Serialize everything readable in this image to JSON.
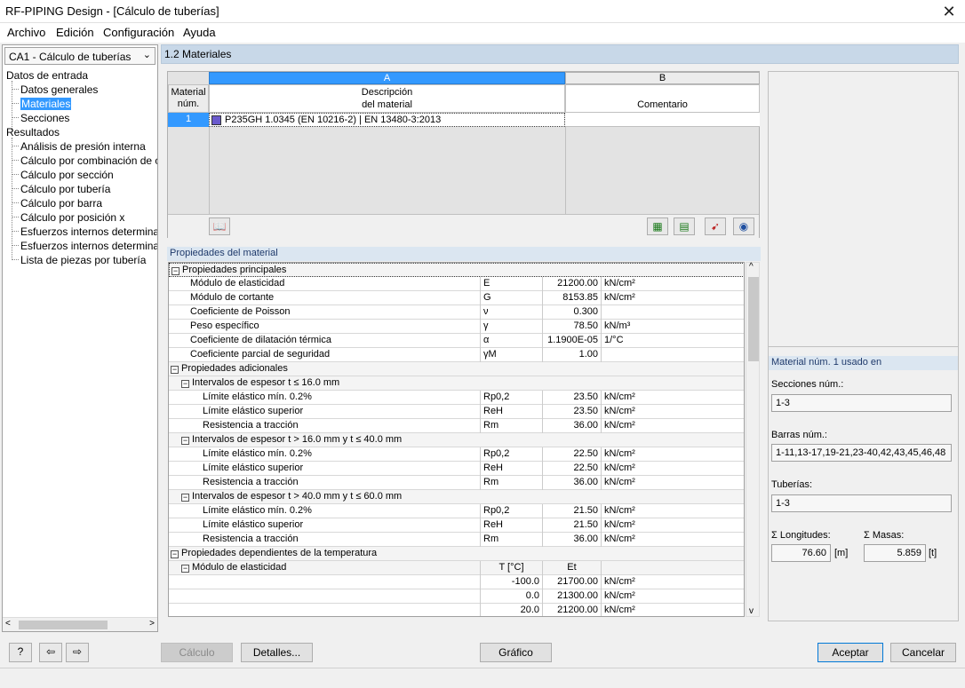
{
  "window": {
    "title": "RF-PIPING Design - [Cálculo de tuberías]"
  },
  "menu": [
    "Archivo",
    "Edición",
    "Configuración",
    "Ayuda"
  ],
  "navigator": {
    "case_select": "CA1 - Cálculo de tuberías",
    "items": [
      {
        "label": "Datos de entrada"
      },
      {
        "label": "Datos generales"
      },
      {
        "label": "Materiales"
      },
      {
        "label": "Secciones"
      },
      {
        "label": "Resultados"
      },
      {
        "label": "Análisis de presión interna"
      },
      {
        "label": "Cálculo por combinación de carg"
      },
      {
        "label": "Cálculo por sección"
      },
      {
        "label": "Cálculo por tubería"
      },
      {
        "label": "Cálculo por barra"
      },
      {
        "label": "Cálculo por posición x"
      },
      {
        "label": "Esfuerzos internos determinante"
      },
      {
        "label": "Esfuerzos internos determinante"
      },
      {
        "label": "Lista de piezas por tubería"
      }
    ]
  },
  "section_title": "1.2 Materiales",
  "materials_table": {
    "col_a": "A",
    "col_b": "B",
    "hdr_num": "Material\nnúm.",
    "hdr_desc": "Descripción\ndel material",
    "hdr_comment": "Comentario",
    "rows": [
      {
        "num": "1",
        "desc": "P235GH 1.0345 (EN 10216-2) | EN 13480-3:2013",
        "comment": "",
        "color": "#6a5acd"
      }
    ]
  },
  "properties": {
    "title": "Propiedades del material",
    "rows": [
      {
        "name": "Propiedades principales",
        "sym": "",
        "val": "",
        "unit": ""
      },
      {
        "name": "Módulo de elasticidad",
        "sym": "E",
        "val": "21200.00",
        "unit": "kN/cm²"
      },
      {
        "name": "Módulo de cortante",
        "sym": "G",
        "val": "8153.85",
        "unit": "kN/cm²"
      },
      {
        "name": "Coeficiente de Poisson",
        "sym": "ν",
        "val": "0.300",
        "unit": ""
      },
      {
        "name": "Peso específico",
        "sym": "γ",
        "val": "78.50",
        "unit": "kN/m³"
      },
      {
        "name": "Coeficiente de dilatación térmica",
        "sym": "α",
        "val": "1.1900E-05",
        "unit": "1/°C"
      },
      {
        "name": "Coeficiente parcial de seguridad",
        "sym": "γM",
        "val": "1.00",
        "unit": ""
      },
      {
        "name": "Propiedades adicionales",
        "sym": "",
        "val": "",
        "unit": ""
      },
      {
        "name": "Intervalos de espesor t ≤ 16.0 mm",
        "sym": "",
        "val": "",
        "unit": ""
      },
      {
        "name": "Límite elástico mín. 0.2%",
        "sym": "Rp0,2",
        "val": "23.50",
        "unit": "kN/cm²"
      },
      {
        "name": "Límite elástico superior",
        "sym": "ReH",
        "val": "23.50",
        "unit": "kN/cm²"
      },
      {
        "name": "Resistencia a tracción",
        "sym": "Rm",
        "val": "36.00",
        "unit": "kN/cm²"
      },
      {
        "name": "Intervalos de espesor t > 16.0 mm y t ≤ 40.0 mm",
        "sym": "",
        "val": "",
        "unit": ""
      },
      {
        "name": "Límite elástico mín. 0.2%",
        "sym": "Rp0,2",
        "val": "22.50",
        "unit": "kN/cm²"
      },
      {
        "name": "Límite elástico superior",
        "sym": "ReH",
        "val": "22.50",
        "unit": "kN/cm²"
      },
      {
        "name": "Resistencia a tracción",
        "sym": "Rm",
        "val": "36.00",
        "unit": "kN/cm²"
      },
      {
        "name": "Intervalos de espesor t > 40.0 mm y t ≤ 60.0 mm",
        "sym": "",
        "val": "",
        "unit": ""
      },
      {
        "name": "Límite elástico mín. 0.2%",
        "sym": "Rp0,2",
        "val": "21.50",
        "unit": "kN/cm²"
      },
      {
        "name": "Límite elástico superior",
        "sym": "ReH",
        "val": "21.50",
        "unit": "kN/cm²"
      },
      {
        "name": "Resistencia a tracción",
        "sym": "Rm",
        "val": "36.00",
        "unit": "kN/cm²"
      },
      {
        "name": "Propiedades dependientes de la temperatura",
        "sym": "",
        "val": "",
        "unit": ""
      },
      {
        "name": "Módulo de elasticidad",
        "sym": "T [°C]",
        "val": "Et",
        "unit": ""
      },
      {
        "name": "",
        "sym": "-100.0",
        "val": "21700.00",
        "unit": "kN/cm²"
      },
      {
        "name": "",
        "sym": "0.0",
        "val": "21300.00",
        "unit": "kN/cm²"
      },
      {
        "name": "",
        "sym": "20.0",
        "val": "21200.00",
        "unit": "kN/cm²"
      }
    ]
  },
  "usage": {
    "title": "Material núm. 1 usado en",
    "sections_label": "Secciones núm.:",
    "sections_value": "1-3",
    "bars_label": "Barras núm.:",
    "bars_value": "1-11,13-17,19-21,23-40,42,43,45,46,48",
    "pipes_label": "Tuberías:",
    "pipes_value": "1-3",
    "len_label": "Σ Longitudes:",
    "len_value": "76.60",
    "len_unit": "[m]",
    "mass_label": "Σ Masas:",
    "mass_value": "5.859",
    "mass_unit": "[t]"
  },
  "buttons": {
    "calc": "Cálculo",
    "details": "Detalles...",
    "graph": "Gráfico",
    "ok": "Aceptar",
    "cancel": "Cancelar"
  }
}
